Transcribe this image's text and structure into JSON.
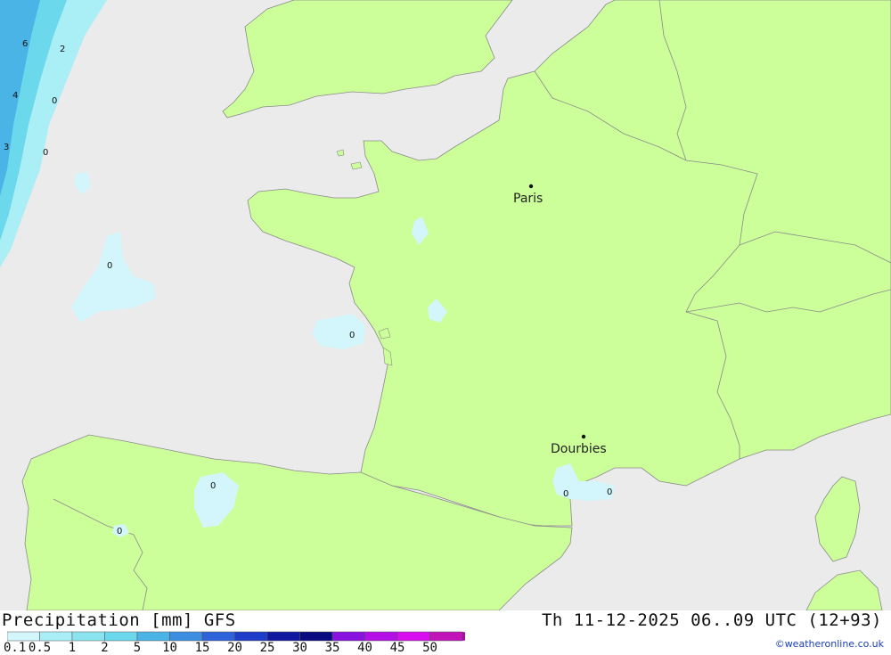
{
  "map": {
    "colors": {
      "sea": "#ebebeb",
      "land": "#ccff99",
      "border": "#8a8a8a",
      "precip_0_1": "#d2f6fb",
      "precip_0_5": "#aaeef6",
      "precip_2": "#6cd8ec",
      "precip_5": "#4ab4e6"
    },
    "cities": [
      {
        "name": "Paris"
      },
      {
        "name": "Dourbies"
      }
    ],
    "value_labels": [
      "6",
      "2",
      "4",
      "0",
      "3",
      "0",
      "0",
      "0",
      "0",
      "0",
      "0",
      "0"
    ]
  },
  "footer": {
    "title_left": "Precipitation [mm] GFS",
    "title_right": "Th 11-12-2025 06..09 UTC (12+93)",
    "credit": "©weatheronline.co.uk",
    "scale_ticks": [
      "0.1",
      "0.5",
      "1",
      "2",
      "5",
      "10",
      "15",
      "20",
      "25",
      "30",
      "35",
      "40",
      "45",
      "50"
    ],
    "scale_colors": [
      "#d2f6fb",
      "#aaeef6",
      "#8ae4ef",
      "#6cd8ec",
      "#4ab4e6",
      "#3c8ee0",
      "#2e62d8",
      "#1e3cc8",
      "#1018a0",
      "#0a0a80",
      "#8a12e0",
      "#b40ee6",
      "#d80ef0",
      "#c014b8",
      "#a0109a"
    ]
  }
}
